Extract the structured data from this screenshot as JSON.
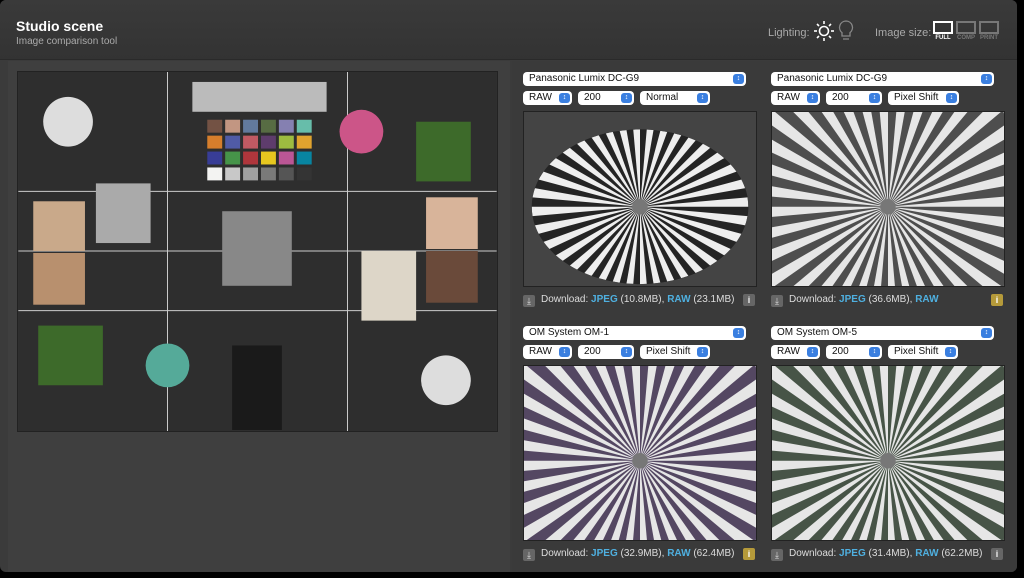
{
  "header": {
    "title": "Studio scene",
    "subtitle": "Image comparison tool",
    "lighting_label": "Lighting:",
    "image_size_label": "Image size:",
    "lighting_icons": [
      "sun-icon",
      "bulb-icon"
    ],
    "sizes": [
      {
        "label": "FULL",
        "active": true
      },
      {
        "label": "COMP",
        "active": false
      },
      {
        "label": "PRINT",
        "active": false
      }
    ]
  },
  "panels": [
    {
      "camera": "Panasonic Lumix DC-G9",
      "format": "RAW",
      "iso": "200",
      "mode": "Normal",
      "download_label": "Download:",
      "jpeg": "JPEG",
      "jpeg_size": "(10.8MB),",
      "raw": "RAW",
      "raw_size": "(23.1MB)",
      "info_warning": false,
      "tint": "#000000"
    },
    {
      "camera": "Panasonic Lumix DC-G9",
      "format": "RAW",
      "iso": "200",
      "mode": "Pixel Shift",
      "download_label": "Download:",
      "jpeg": "JPEG",
      "jpeg_size": "(36.6MB),",
      "raw": "RAW",
      "raw_size": "",
      "info_warning": true,
      "tint": "#333333"
    },
    {
      "camera": "OM System OM-1",
      "format": "RAW",
      "iso": "200",
      "mode": "Pixel Shift",
      "download_label": "Download:",
      "jpeg": "JPEG",
      "jpeg_size": "(32.9MB),",
      "raw": "RAW",
      "raw_size": "(62.4MB)",
      "info_warning": true,
      "tint": "#3a2a4a"
    },
    {
      "camera": "OM System OM-5",
      "format": "RAW",
      "iso": "200",
      "mode": "Pixel Shift",
      "download_label": "Download:",
      "jpeg": "JPEG",
      "jpeg_size": "(31.4MB),",
      "raw": "RAW",
      "raw_size": "(62.2MB)",
      "info_warning": false,
      "tint": "#2a3a2a"
    }
  ],
  "colors": {
    "link": "#4fb0e0",
    "select_arrow": "#3a7fe0",
    "warning": "#b59a3a"
  }
}
